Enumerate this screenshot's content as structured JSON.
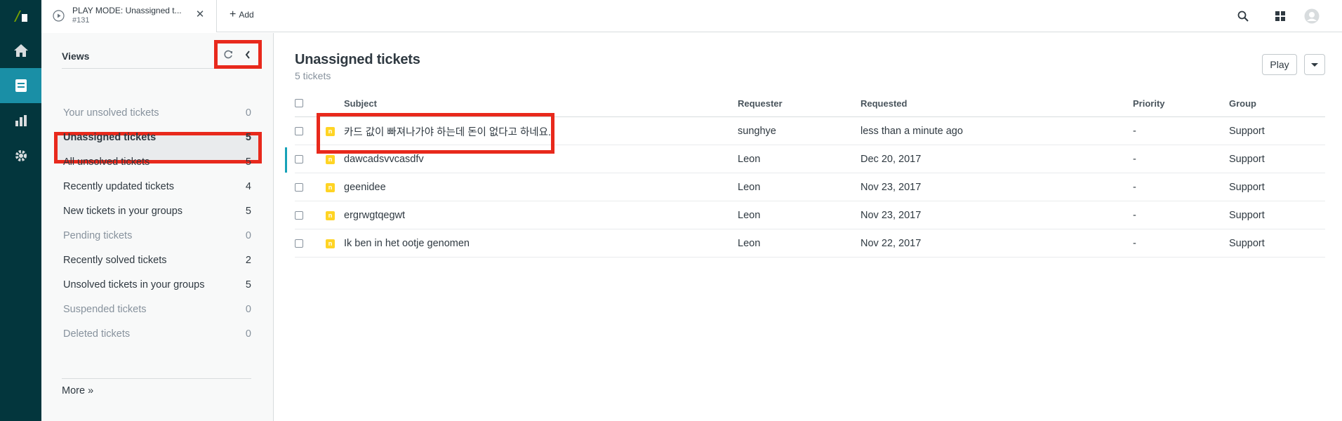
{
  "header": {
    "tab_title": "PLAY MODE: Unassigned t...",
    "tab_subtitle": "#131",
    "add_label": "Add"
  },
  "views": {
    "title": "Views",
    "items": [
      {
        "label": "Your unsolved tickets",
        "count": "0"
      },
      {
        "label": "Unassigned tickets",
        "count": "5"
      },
      {
        "label": "All unsolved tickets",
        "count": "5"
      },
      {
        "label": "Recently updated tickets",
        "count": "4"
      },
      {
        "label": "New tickets in your groups",
        "count": "5"
      },
      {
        "label": "Pending tickets",
        "count": "0"
      },
      {
        "label": "Recently solved tickets",
        "count": "2"
      },
      {
        "label": "Unsolved tickets in your groups",
        "count": "5"
      },
      {
        "label": "Suspended tickets",
        "count": "0"
      },
      {
        "label": "Deleted tickets",
        "count": "0"
      }
    ],
    "more_label": "More »"
  },
  "main": {
    "title": "Unassigned tickets",
    "subtitle": "5 tickets",
    "play_label": "Play",
    "columns": {
      "subject": "Subject",
      "requester": "Requester",
      "requested": "Requested",
      "priority": "Priority",
      "group": "Group"
    },
    "status_letter": "n",
    "rows": [
      {
        "subject": "카드 값이 빠져나가야 하는데 돈이 없다고 하네요.",
        "requester": "sunghye",
        "requested": "less than a minute ago",
        "priority": "-",
        "group": "Support"
      },
      {
        "subject": "dawcadsvvcasdfv",
        "requester": "Leon",
        "requested": "Dec 20, 2017",
        "priority": "-",
        "group": "Support"
      },
      {
        "subject": "geenidee",
        "requester": "Leon",
        "requested": "Nov 23, 2017",
        "priority": "-",
        "group": "Support"
      },
      {
        "subject": "ergrwgtqegwt",
        "requester": "Leon",
        "requested": "Nov 23, 2017",
        "priority": "-",
        "group": "Support"
      },
      {
        "subject": "Ik ben in het ootje genomen",
        "requester": "Leon",
        "requested": "Nov 22, 2017",
        "priority": "-",
        "group": "Support"
      }
    ]
  },
  "colors": {
    "rail": "#03363d",
    "rail_active": "#1a8fa6",
    "highlight": "#e8291c",
    "status_new": "#ffd424"
  },
  "icons": {
    "rail": [
      "zendesk-logo",
      "home-icon",
      "views-icon",
      "reporting-icon",
      "admin-gear-icon"
    ],
    "top": [
      "search-icon",
      "products-grid-icon",
      "avatar"
    ]
  }
}
